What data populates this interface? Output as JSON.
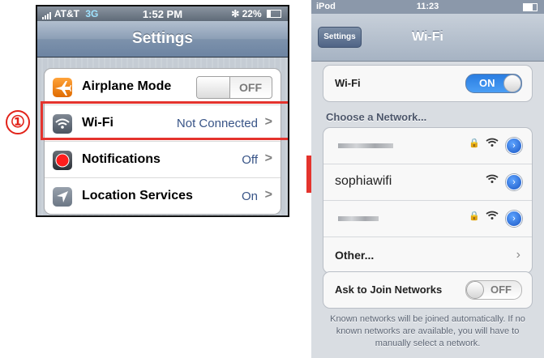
{
  "callout": {
    "number": "①"
  },
  "left_phone": {
    "status": {
      "carrier": "AT&T",
      "network": "3G",
      "time": "1:52 PM",
      "bluetooth": "✻",
      "battery": "22%"
    },
    "title": "Settings",
    "rows": [
      {
        "label": "Airplane Mode",
        "switch": "OFF",
        "icon": "airplane-icon"
      },
      {
        "label": "Wi-Fi",
        "value": "Not Connected",
        "icon": "wifi-icon"
      },
      {
        "label": "Notifications",
        "value": "Off",
        "icon": "notifications-icon"
      },
      {
        "label": "Location Services",
        "value": "On",
        "icon": "location-icon"
      }
    ],
    "chevron": ">"
  },
  "right_phone": {
    "status": {
      "device": "iPod",
      "time": "11:23"
    },
    "back_label": "Settings",
    "title": "Wi-Fi",
    "wifi_row": {
      "label": "Wi-Fi",
      "toggle": "ON"
    },
    "choose_label": "Choose a Network...",
    "networks": [
      {
        "name": "",
        "locked": true
      },
      {
        "name": "sophiawifi",
        "locked": false
      },
      {
        "name": "",
        "locked": true
      },
      {
        "name": "Other...",
        "other": true
      }
    ],
    "ask_row": {
      "label": "Ask to Join Networks",
      "toggle": "OFF"
    },
    "footer": "Known networks will be joined automatically. If no known networks are available, you will have to manually select a network."
  },
  "colors": {
    "highlight": "#e4332d",
    "switch_on": "#2a7de1",
    "value_text": "#385487"
  }
}
